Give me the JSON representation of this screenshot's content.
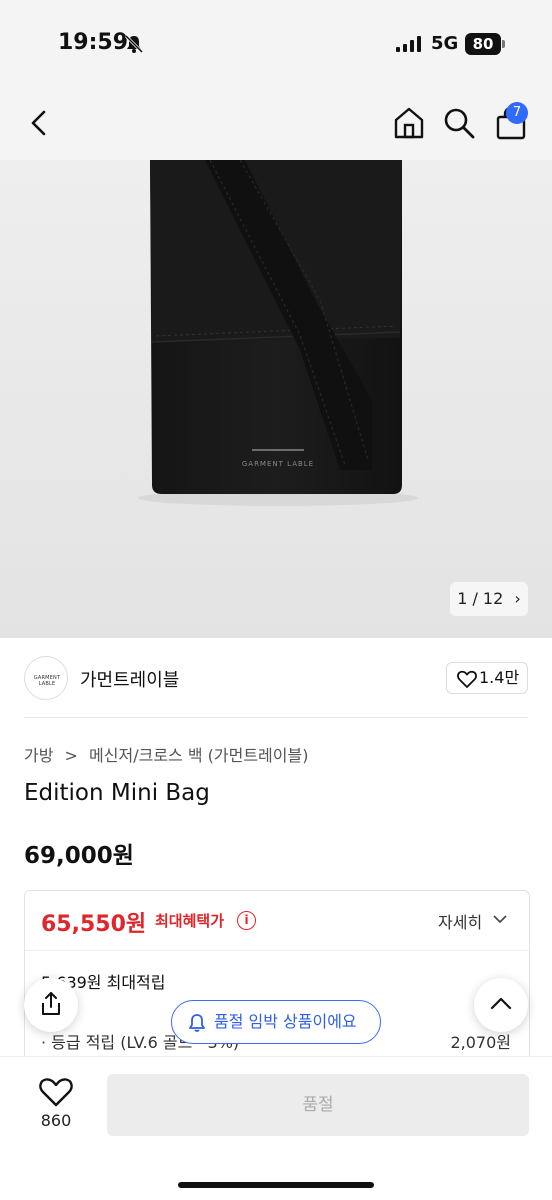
{
  "status_bar": {
    "time": "19:59",
    "network": "5G",
    "battery": "80"
  },
  "nav": {
    "cart_count": "7"
  },
  "gallery": {
    "counter": "1 / 12",
    "logo_text": "GARMENT LABLE"
  },
  "brand": {
    "name": "가먼트레이블",
    "likes": "1.4만",
    "logo_text": "GARMENT LABLE"
  },
  "breadcrumb": {
    "category": "가방",
    "subcategory": "메신저/크로스 백 (가먼트레이블)"
  },
  "product": {
    "title": "Edition Mini Bag",
    "price": "69,000원"
  },
  "benefits": {
    "discount_price": "65,550원",
    "max_benefit_label": "최대혜택가",
    "detail_label": "자세히",
    "points": "5,639원 최대적립",
    "level_label": "· 등급 적립 (LV.6 골드 · 3%)",
    "level_amount": "2,070원"
  },
  "notice": {
    "low_stock": "품절 임박 상품이에요"
  },
  "bottom": {
    "wish_count": "860",
    "buy_label": "품절"
  },
  "colors": {
    "accent_red": "#e0262a",
    "accent_blue": "#2f6bff"
  }
}
